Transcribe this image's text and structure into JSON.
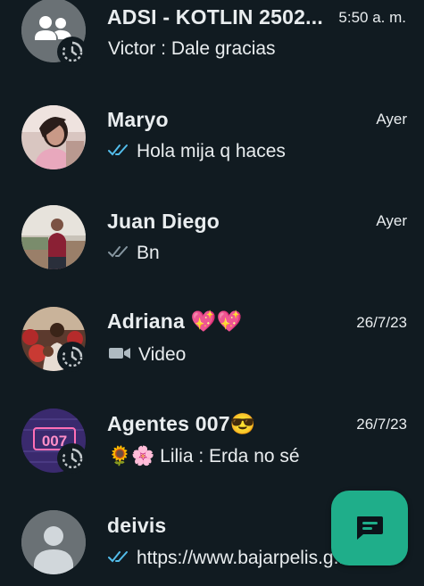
{
  "chats": [
    {
      "name": "ADSI - KOTLIN 2502...",
      "time": "5:50 a. m.",
      "sender": "Victor : ",
      "message": "Dale gracias"
    },
    {
      "name": "Maryo",
      "time": "Ayer",
      "message": "Hola mija q haces",
      "status": "read"
    },
    {
      "name": "Juan Diego",
      "time": "Ayer",
      "message": "Bn",
      "status": "delivered"
    },
    {
      "name": "Adriana 💖💖",
      "time": "26/7/23",
      "message": "Video"
    },
    {
      "name": "Agentes 007😎",
      "time": "26/7/23",
      "prefix": "🌻🌸 ",
      "sender": "Lilia : ",
      "message": "Erda no sé"
    },
    {
      "name": "deivis",
      "message": "https://www.bajarpelis.g...",
      "status": "read"
    }
  ],
  "icons": {
    "group_avatar": "group-avatar-icon",
    "default_avatar": "person-avatar-icon",
    "timer": "disappearing-timer-icon",
    "read_ticks": "double-check-blue-icon",
    "delivered_ticks": "double-check-grey-icon",
    "video": "video-camera-icon",
    "new_chat": "new-chat-icon"
  },
  "colors": {
    "background": "#111b21",
    "text": "#e9edef",
    "read_ticks": "#53bdeb",
    "delivered_ticks": "#8696a0",
    "fab": "#1fae8a"
  }
}
